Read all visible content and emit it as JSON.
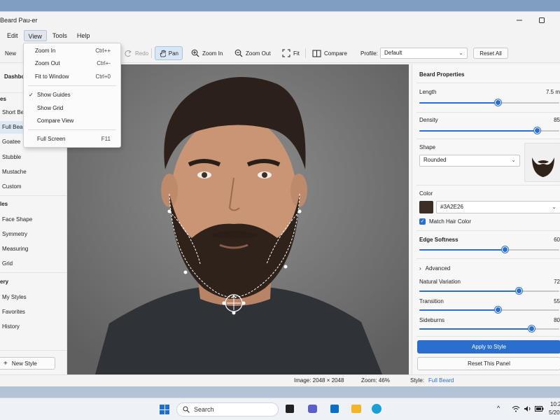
{
  "window": {
    "title": "Beard Pau-er"
  },
  "menubar": {
    "items": [
      "Edit",
      "View",
      "Tools",
      "Help"
    ],
    "active": "View"
  },
  "toolbar": {
    "new_label": "New",
    "redo_label": "Redo",
    "pan_label": "Pan",
    "zoom_in_label": "Zoom In",
    "zoom_out_label": "Zoom Out",
    "fit_label": "Fit",
    "compare_label": "Compare",
    "profile_label": "Profile:",
    "profile_value": "Default",
    "reset_all_label": "Reset All"
  },
  "view_menu": {
    "items": [
      {
        "label": "Zoom In",
        "shortcut": "Ctrl++"
      },
      {
        "label": "Zoom Out",
        "shortcut": "Ctrl+-"
      },
      {
        "label": "Fit to Window",
        "shortcut": "Ctrl+0"
      },
      {
        "label": "Show Guides",
        "shortcut": "",
        "checked": true
      },
      {
        "label": "Show Grid",
        "shortcut": ""
      },
      {
        "label": "Compare View",
        "shortcut": ""
      },
      {
        "label": "Full Screen",
        "shortcut": "F11"
      }
    ]
  },
  "sidebar": {
    "dashboard_label": "Dashbo",
    "styles_head": "es",
    "styles": [
      "Short Bea",
      "Full Bear",
      "Goatee",
      "Stubble",
      "Mustache",
      "Custom"
    ],
    "selected_style": "Full Bear",
    "tools_head": "les",
    "tools": [
      "Face Shape",
      "Symmetry",
      "Measuring",
      "Grid"
    ],
    "gallery_head": "ery",
    "gallery": [
      "My Styles",
      "Favorites",
      "History"
    ],
    "new_style_label": "New Style"
  },
  "panel": {
    "title": "Beard Properties",
    "length_label": "Length",
    "length_value": "7.5 m",
    "length_fraction": 0.56,
    "density_label": "Density",
    "density_value": "85",
    "density_fraction": 0.84,
    "shape_label": "Shape",
    "shape_value": "Rounded",
    "color_label": "Color",
    "color_hex": "#3A2E26",
    "color_swatch": "#3a2e26",
    "match_hair_label": "Match Hair Color",
    "match_hair_checked": true,
    "edge_label": "Edge Softness",
    "edge_value": "60",
    "edge_fraction": 0.61,
    "advanced_label": "Advanced",
    "natural_label": "Natural Variation",
    "natural_value": "72",
    "natural_fraction": 0.71,
    "transition_label": "Transition",
    "transition_value": "55",
    "transition_fraction": 0.56,
    "sideburns_label": "Sideburns",
    "sideburns_value": "80",
    "sideburns_fraction": 0.8,
    "apply_label": "Apply to Style",
    "reset_panel_label": "Reset This Panel"
  },
  "status": {
    "image_text": "Image: 2048 × 2048",
    "zoom_text": "Zoom: 46%",
    "style_label": "Style:",
    "style_value": "Full Beard"
  },
  "taskbar": {
    "search_placeholder": "Search",
    "time": "10:2",
    "date": "5/20"
  },
  "colors": {
    "accent": "#2b6fce",
    "selection": "#dde8f5"
  }
}
